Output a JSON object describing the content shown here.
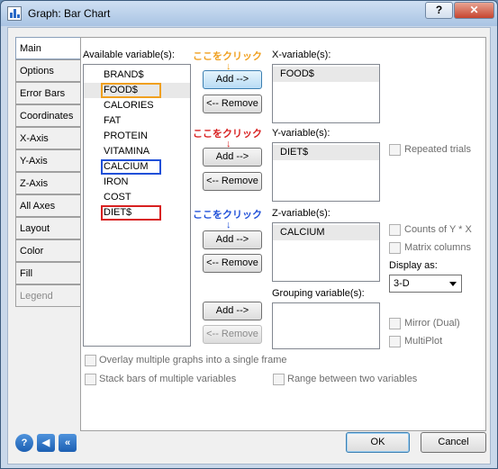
{
  "window": {
    "title": "Graph: Bar Chart",
    "help_glyph": "?",
    "close_glyph": "✕"
  },
  "tabs": [
    "Main",
    "Options",
    "Error Bars",
    "Coordinates",
    "X-Axis",
    "Y-Axis",
    "Z-Axis",
    "All Axes",
    "Layout",
    "Color",
    "Fill",
    "Legend"
  ],
  "available": {
    "label": "Available variable(s):",
    "items": [
      "BRAND$",
      "FOOD$",
      "CALORIES",
      "FAT",
      "PROTEIN",
      "VITAMINA",
      "CALCIUM",
      "IRON",
      "COST",
      "DIET$"
    ]
  },
  "annotations": {
    "note_text": "ここをクリック",
    "arrow": "↓",
    "colors": {
      "orange": "#f0a020",
      "blue": "#2050d8",
      "red": "#d82020"
    }
  },
  "buttons": {
    "add": "Add -->",
    "remove": "<-- Remove",
    "ok": "OK",
    "cancel": "Cancel"
  },
  "x_var": {
    "label": "X-variable(s):",
    "items": [
      "FOOD$"
    ]
  },
  "y_var": {
    "label": "Y-variable(s):",
    "items": [
      "DIET$"
    ]
  },
  "z_var": {
    "label": "Z-variable(s):",
    "items": [
      "CALCIUM"
    ]
  },
  "grouping": {
    "label": "Grouping variable(s):",
    "items": []
  },
  "right_options": {
    "repeated_trials": "Repeated trials",
    "counts_of_y": "Counts of Y * X",
    "matrix_columns": "Matrix columns",
    "display_as_label": "Display as:",
    "display_as_value": "3-D",
    "mirror": "Mirror (Dual)",
    "multiplot": "MultiPlot"
  },
  "bottom_options": {
    "overlay": "Overlay multiple graphs into a single frame",
    "stack": "Stack bars of multiple variables",
    "range": "Range between two variables"
  },
  "nav_icons": {
    "help": "?",
    "back": "◀",
    "back_all": "«"
  }
}
